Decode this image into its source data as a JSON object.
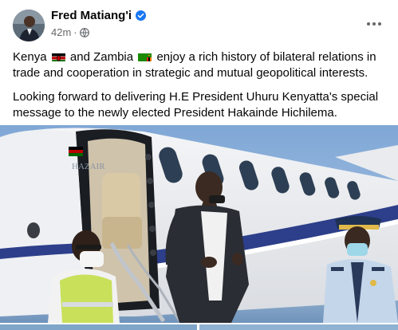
{
  "post": {
    "author": "Fred Matiang'i",
    "time": "42m",
    "time_separator": "·",
    "paragraph1": {
      "part1": "Kenya",
      "part2": "and Zambia",
      "part3": "enjoy a rich history of bilateral relations in trade and cooperation in strategic and mutual geopolitical interests."
    },
    "paragraph2": "Looking forward to delivering H.E President Uhuru Kenyatta's special message to the newly elected President Hakainde Hichilema.",
    "aircraft_logo": "HAZAIR"
  },
  "icons": {
    "verified": "verified-badge-icon",
    "privacy": "globe-icon",
    "more": "more-options-icon",
    "flag_kenya": "kenya-flag-icon",
    "flag_zambia": "zambia-flag-icon"
  },
  "colors": {
    "name": "#050505",
    "meta": "#65676b",
    "verified": "#1877f2",
    "jet_stripe": "#2d3f8a"
  }
}
